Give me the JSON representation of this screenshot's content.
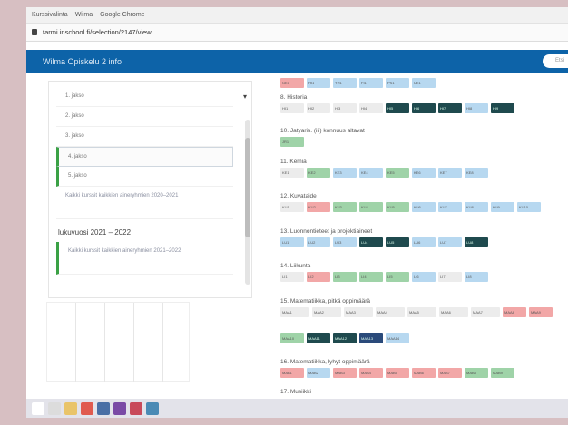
{
  "browser": {
    "tab_labels": [
      "Kurssivalinta",
      "Wilma",
      "Google Chrome"
    ],
    "url": "tarmi.inschool.fi/selection/2147/view"
  },
  "app": {
    "title": "Wilma Opiskelu 2 info",
    "search_placeholder": "Etsi"
  },
  "sidebar": {
    "grades": [
      {
        "label": "1. jakso",
        "state": "normal"
      },
      {
        "label": "2. jakso",
        "state": "normal"
      },
      {
        "label": "3. jakso",
        "state": "normal"
      },
      {
        "label": "4. jakso",
        "state": "selected"
      },
      {
        "label": "5. jakso",
        "state": "active"
      }
    ],
    "plan_link_1": "Kaikki kurssit kaikkien aineryhmien 2020–2021",
    "year_heading": "lukuvuosi 2021 – 2022",
    "plan_link_2": "Kaikki kurssit kaikkien aineryhmien 2021–2022"
  },
  "subjects": [
    {
      "title": "",
      "chips": [
        {
          "label": "GE1",
          "color": "#f2a7a7"
        },
        {
          "label": "HI1",
          "color": "#b7d8f0"
        },
        {
          "label": "YH1",
          "color": "#b7d8f0"
        },
        {
          "label": "FI1",
          "color": "#b7d8f0"
        },
        {
          "label": "PS1",
          "color": "#b7d8f0"
        },
        {
          "label": "UE1",
          "color": "#b7d8f0"
        }
      ]
    },
    {
      "title": "8. Historia",
      "chips": [
        {
          "label": "HI1",
          "color": "#ececec"
        },
        {
          "label": "HI2",
          "color": "#ececec"
        },
        {
          "label": "HI3",
          "color": "#ececec"
        },
        {
          "label": "HI4",
          "color": "#ececec"
        },
        {
          "label": "HI5",
          "color": "#1f4a4e"
        },
        {
          "label": "HI6",
          "color": "#1f4a4e"
        },
        {
          "label": "HI7",
          "color": "#1f4a4e"
        },
        {
          "label": "HI8",
          "color": "#b7d8f0"
        },
        {
          "label": "HI9",
          "color": "#1f4a4e"
        }
      ]
    },
    {
      "title": "10. Jatyaris. (ili) konnuus altavat",
      "chips": [
        {
          "label": "JR1",
          "color": "#9fd3a8"
        }
      ]
    },
    {
      "title": "11. Kemia",
      "chips": [
        {
          "label": "KE1",
          "color": "#ececec"
        },
        {
          "label": "KE2",
          "color": "#9fd3a8"
        },
        {
          "label": "KE3",
          "color": "#b7d8f0"
        },
        {
          "label": "KE4",
          "color": "#b7d8f0"
        },
        {
          "label": "KE5",
          "color": "#9fd3a8"
        },
        {
          "label": "KE6",
          "color": "#b7d8f0"
        },
        {
          "label": "KE7",
          "color": "#b7d8f0"
        },
        {
          "label": "KE8",
          "color": "#b7d8f0"
        }
      ]
    },
    {
      "title": "12. Kuvataide",
      "chips": [
        {
          "label": "KU1",
          "color": "#ececec"
        },
        {
          "label": "KU2",
          "color": "#f2a7a7"
        },
        {
          "label": "KU3",
          "color": "#9fd3a8"
        },
        {
          "label": "KU4",
          "color": "#9fd3a8"
        },
        {
          "label": "KU5",
          "color": "#9fd3a8"
        },
        {
          "label": "KU6",
          "color": "#b7d8f0"
        },
        {
          "label": "KU7",
          "color": "#b7d8f0"
        },
        {
          "label": "KU8",
          "color": "#b7d8f0"
        },
        {
          "label": "KU9",
          "color": "#b7d8f0"
        },
        {
          "label": "KU10",
          "color": "#b7d8f0"
        }
      ]
    },
    {
      "title": "13. Luonnontieteet ja projektiaineet",
      "chips": [
        {
          "label": "LU1",
          "color": "#b7d8f0"
        },
        {
          "label": "LU2",
          "color": "#b7d8f0"
        },
        {
          "label": "LU3",
          "color": "#b7d8f0"
        },
        {
          "label": "LU4",
          "color": "#1f4a4e"
        },
        {
          "label": "LU5",
          "color": "#1f4a4e"
        },
        {
          "label": "LU6",
          "color": "#b7d8f0"
        },
        {
          "label": "LU7",
          "color": "#b7d8f0"
        },
        {
          "label": "LU8",
          "color": "#1f4a4e"
        }
      ]
    },
    {
      "title": "14. Liikunta",
      "chips": [
        {
          "label": "LI1",
          "color": "#ececec"
        },
        {
          "label": "LI2",
          "color": "#f2a7a7"
        },
        {
          "label": "LI3",
          "color": "#9fd3a8"
        },
        {
          "label": "LI4",
          "color": "#9fd3a8"
        },
        {
          "label": "LI5",
          "color": "#9fd3a8"
        },
        {
          "label": "LI6",
          "color": "#b7d8f0"
        },
        {
          "label": "LI7",
          "color": "#ececec"
        },
        {
          "label": "LI8",
          "color": "#b7d8f0"
        }
      ]
    },
    {
      "title": "15. Matematiikka, pitkä oppimäärä",
      "chips": [
        {
          "label": "MAA1",
          "color": "#ececec"
        },
        {
          "label": "MAA2",
          "color": "#ececec"
        },
        {
          "label": "MAA3",
          "color": "#ececec"
        },
        {
          "label": "MAA4",
          "color": "#ececec"
        },
        {
          "label": "MAA5",
          "color": "#ececec"
        },
        {
          "label": "MAA6",
          "color": "#ececec"
        },
        {
          "label": "MAA7",
          "color": "#ececec"
        },
        {
          "label": "MAA8",
          "color": "#f2a7a7"
        },
        {
          "label": "MAA9",
          "color": "#f2a7a7"
        }
      ]
    },
    {
      "title": "",
      "chips": [
        {
          "label": "MAA10",
          "color": "#9fd3a8"
        },
        {
          "label": "MAA11",
          "color": "#1f4a4e"
        },
        {
          "label": "MAA12",
          "color": "#1f4a4e"
        },
        {
          "label": "MAA13",
          "color": "#2a4a7a"
        },
        {
          "label": "MAA14",
          "color": "#b7d8f0"
        }
      ]
    },
    {
      "title": "16. Matematiikka, lyhyt oppimäärä",
      "chips": [
        {
          "label": "MAB1",
          "color": "#f2a7a7"
        },
        {
          "label": "MAB2",
          "color": "#b7d8f0"
        },
        {
          "label": "MAB3",
          "color": "#f2a7a7"
        },
        {
          "label": "MAB4",
          "color": "#f2a7a7"
        },
        {
          "label": "MAB5",
          "color": "#f2a7a7"
        },
        {
          "label": "MAB6",
          "color": "#f2a7a7"
        },
        {
          "label": "MAB7",
          "color": "#f2a7a7"
        },
        {
          "label": "MAB8",
          "color": "#9fd3a8"
        },
        {
          "label": "MAB9",
          "color": "#9fd3a8"
        }
      ]
    },
    {
      "title": "17. Musiikki",
      "chips": []
    }
  ],
  "taskbar": {
    "icons": [
      {
        "name": "start-icon",
        "color": "#ffffff"
      },
      {
        "name": "search-icon",
        "color": "#dcdcdc"
      },
      {
        "name": "explorer-icon",
        "color": "#e9c46a"
      },
      {
        "name": "chrome-icon",
        "color": "#e05a4e"
      },
      {
        "name": "app-icon",
        "color": "#4a6fa5"
      },
      {
        "name": "app-icon",
        "color": "#7a4aa5"
      },
      {
        "name": "app-icon",
        "color": "#c84a5a"
      },
      {
        "name": "app-icon",
        "color": "#4a8ab5"
      }
    ]
  }
}
